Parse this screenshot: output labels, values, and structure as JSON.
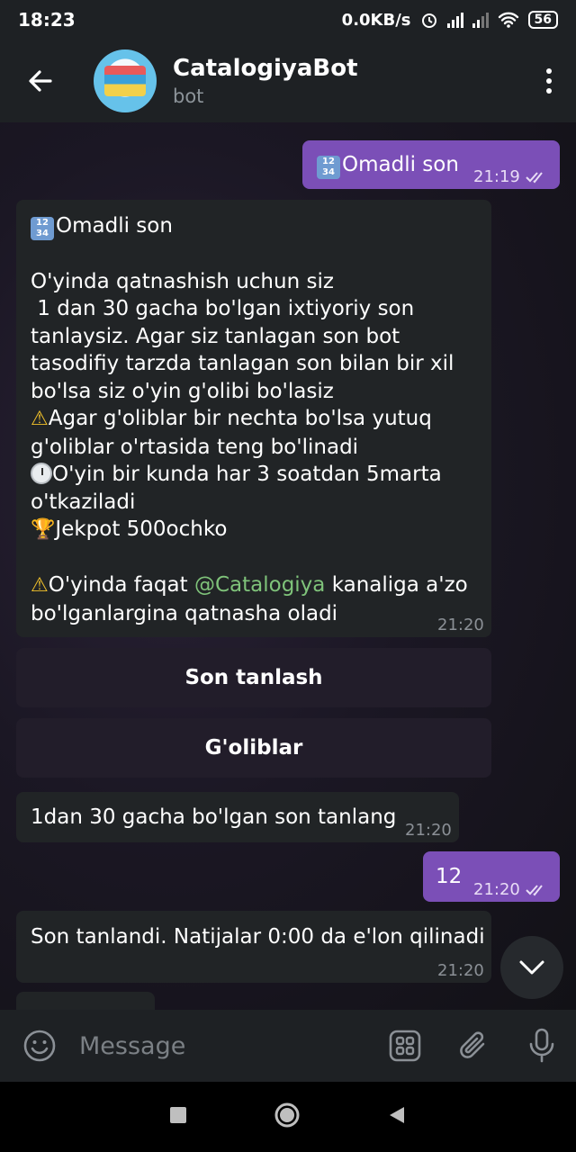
{
  "status_bar": {
    "time": "18:23",
    "net_speed": "0.0KB/s",
    "battery": "56"
  },
  "header": {
    "title": "CatalogiyaBot",
    "subtitle": "bot"
  },
  "messages": {
    "m1": {
      "text": "Omadli son",
      "time": "21:19"
    },
    "m2": {
      "line1": "Omadli son",
      "line2": "O'yinda qatnashish uchun siz",
      "line3": " 1 dan 30 gacha bo'lgan ixtiyoriy son",
      "line4": "tanlaysiz. Agar siz tanlagan son bot",
      "line5": "tasodifiy tarzda  tanlagan son bilan bir xil",
      "line6": "bo'lsa siz o'yin g'olibi bo'lasiz",
      "line7": "Agar g'oliblar bir nechta bo'lsa yutuq",
      "line8": "g'oliblar o'rtasida teng bo'linadi",
      "line9": "O'yin bir kunda har 3 soatdan 5marta",
      "line10": "o'tkaziladi",
      "line11": "Jekpot 500ochko",
      "line12_pre": "O'yinda faqat ",
      "line12_link": "@Catalogiya",
      "line12_post": " kanaliga a'zo",
      "line13": "bo'lganlargina qatnasha oladi",
      "time": "21:20"
    },
    "m3": {
      "text": "1dan 30 gacha bo'lgan son tanlang",
      "time": "21:20"
    },
    "m4": {
      "text": "12",
      "time": "21:20"
    },
    "m5": {
      "text": "Son tanlandi. Natijalar 0:00 da e'lon qilinadi",
      "time": "21:20"
    }
  },
  "keyboard": {
    "btn1": "Son tanlash",
    "btn2": "G'oliblar"
  },
  "input": {
    "placeholder": "Message"
  },
  "emoji_badge": "1234",
  "icons": [
    "back-arrow-icon",
    "more-vertical-icon",
    "read-checkmark-icon",
    "numbers-emoji-icon",
    "warning-emoji-icon",
    "clock-emoji-icon",
    "trophy-emoji-icon",
    "chevron-down-icon",
    "smile-icon",
    "bot-commands-icon",
    "paperclip-icon",
    "microphone-icon",
    "nav-recents-icon",
    "nav-home-icon",
    "nav-back-icon"
  ]
}
